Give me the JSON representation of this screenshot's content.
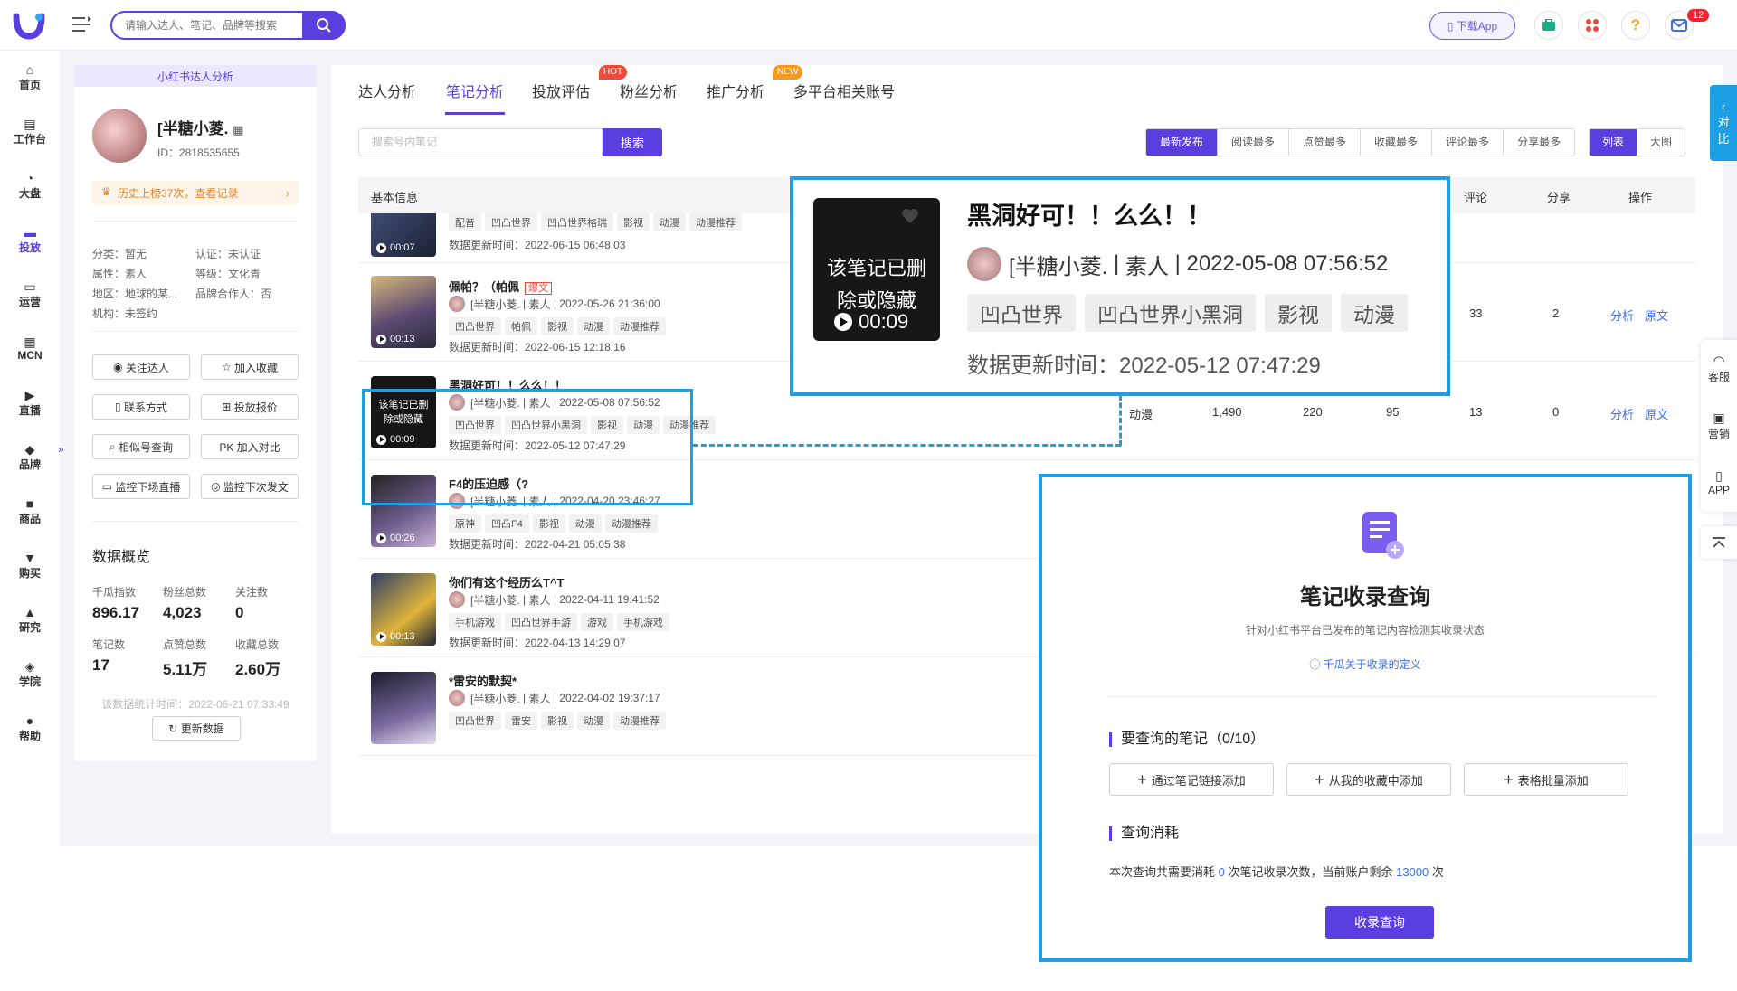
{
  "topbar": {
    "search_placeholder": "请输入达人、笔记、品牌等搜索",
    "download_app": "下载App",
    "mail_count": "12"
  },
  "nav": [
    {
      "label": "首页",
      "icon": "home-icon"
    },
    {
      "label": "工作台",
      "icon": "workbench-icon"
    },
    {
      "label": "大盘",
      "icon": "pie-chart-icon"
    },
    {
      "label": "投放",
      "icon": "folder-icon"
    },
    {
      "label": "运营",
      "icon": "chat-icon"
    },
    {
      "label": "MCN",
      "icon": "building-icon"
    },
    {
      "label": "直播",
      "icon": "camera-icon"
    },
    {
      "label": "品牌",
      "icon": "bag-icon"
    },
    {
      "label": "商品",
      "icon": "shop-icon"
    },
    {
      "label": "购买",
      "icon": "cart-icon"
    },
    {
      "label": "研究",
      "icon": "flask-icon"
    },
    {
      "label": "学院",
      "icon": "graduation-icon"
    },
    {
      "label": "帮助",
      "icon": "help-icon"
    }
  ],
  "profile": {
    "header": "小红书达人分析",
    "name": "[半糖小菱.",
    "id": "ID：2818535655",
    "history": "历史上榜37次，查看记录",
    "category": "分类：暂无",
    "cert": "认证：未认证",
    "attr": "属性：素人",
    "level": "等级：文化青",
    "region": "地区：地球的某...",
    "brand_partner": "品牌合作人：否",
    "org": "机构：未签约",
    "buttons": [
      "关注达人",
      "加入收藏",
      "联系方式",
      "投放报价",
      "相似号查询",
      "PK 加入对比",
      "监控下场直播",
      "监控下次发文"
    ],
    "overview_title": "数据概览",
    "stats": [
      {
        "label": "千瓜指数",
        "value": "896.17"
      },
      {
        "label": "粉丝总数",
        "value": "4,023"
      },
      {
        "label": "关注数",
        "value": "0"
      },
      {
        "label": "笔记数",
        "value": "17"
      },
      {
        "label": "点赞总数",
        "value": "5.11万"
      },
      {
        "label": "收藏总数",
        "value": "2.60万"
      }
    ],
    "updated": "该数据统计时间：2022-06-21 07:33:49",
    "refresh": "更新数据"
  },
  "tabs": [
    {
      "label": "达人分析"
    },
    {
      "label": "笔记分析"
    },
    {
      "label": "投放评估",
      "badge": "HOT"
    },
    {
      "label": "粉丝分析"
    },
    {
      "label": "推广分析"
    },
    {
      "label": "多平台相关账号",
      "badge": "NEW"
    }
  ],
  "note_search": {
    "placeholder": "搜索号内笔记",
    "button": "搜索"
  },
  "sort": [
    "最新发布",
    "阅读最多",
    "点赞最多",
    "收藏最多",
    "评论最多",
    "分享最多"
  ],
  "view": [
    "列表",
    "大图"
  ],
  "table": {
    "headers": {
      "basic": "基本信息",
      "comment": "评论",
      "share": "分享",
      "action": "操作"
    },
    "rows": [
      {
        "title": "",
        "duration": "00:07",
        "tags": [
          "配音",
          "凹凸世界",
          "凹凸世界格瑞",
          "影视",
          "动漫",
          "动漫推荐"
        ],
        "updated": "数据更新时间：2022-06-15 06:48:03"
      },
      {
        "title": "佩帕？（帕佩",
        "hot": "爆文",
        "duration": "00:13",
        "author": "[半糖小菱.",
        "role": "素人",
        "time": "2022-05-26 21:36:00",
        "tags": [
          "凹凸世界",
          "帕佩",
          "影视",
          "动漫",
          "动漫推荐"
        ],
        "updated": "数据更新时间：2022-06-15 12:18:16",
        "comment": "33",
        "share": "2"
      },
      {
        "title": "黑洞好可！！么么！！",
        "duration": "00:09",
        "deleted": "该笔记已删除或隐藏",
        "author": "[半糖小菱.",
        "role": "素人",
        "time": "2022-05-08 07:56:52",
        "tags": [
          "凹凸世界",
          "凹凸世界小黑洞",
          "影视",
          "动漫",
          "动漫推荐"
        ],
        "updated": "数据更新时间：2022-05-12 07:47:29",
        "category": "动漫",
        "reads": "1,490",
        "likes": "220",
        "collects": "95",
        "comment": "13",
        "share": "0"
      },
      {
        "title": "F4的压迫感（?",
        "duration": "00:26",
        "author": "[半糖小菱.",
        "role": "素人",
        "time": "2022-04-20 23:46:27",
        "tags": [
          "原神",
          "凹凸F4",
          "影视",
          "动漫",
          "动漫推荐"
        ],
        "updated": "数据更新时间：2022-04-21 05:05:38"
      },
      {
        "title": "你们有这个经历么T^T",
        "duration": "00:13",
        "author": "[半糖小菱.",
        "role": "素人",
        "time": "2022-04-11 19:41:52",
        "tags": [
          "手机游戏",
          "凹凸世界手游",
          "游戏",
          "手机游戏"
        ],
        "updated": "数据更新时间：2022-04-13 14:29:07"
      },
      {
        "title": "*雷安的默契*",
        "duration": "",
        "author": "[半糖小菱.",
        "role": "素人",
        "time": "2022-04-02 19:37:17",
        "tags": [
          "凹凸世界",
          "雷安",
          "影视",
          "动漫",
          "动漫推荐"
        ]
      }
    ],
    "actions": {
      "analyze": "分析",
      "source": "原文"
    }
  },
  "zoom": {
    "deleted": "该笔记已删除或隐藏",
    "duration": "00:09",
    "title": "黑洞好可！！么么！！",
    "author": "[半糖小菱.",
    "role": "素人",
    "time": "2022-05-08 07:56:52",
    "tags": [
      "凹凸世界",
      "凹凸世界小黑洞",
      "影视",
      "动漫"
    ],
    "updated": "数据更新时间：2022-05-12 07:47:29"
  },
  "query": {
    "title": "笔记收录查询",
    "subtitle": "针对小红书平台已发布的笔记内容检测其收录状态",
    "link": "千瓜关于收录的定义",
    "section1": "要查询的笔记（0/10）",
    "buttons": [
      "通过笔记链接添加",
      "从我的收藏中添加",
      "表格批量添加"
    ],
    "section2": "查询消耗",
    "cost_pre": "本次查询共需要消耗",
    "cost_num": "0",
    "cost_mid": "次笔记收录次数，当前账户剩余",
    "cost_left": "13000",
    "cost_post": "次",
    "submit": "收录查询"
  },
  "right": {
    "compare": [
      "对",
      "比"
    ],
    "service": "客服",
    "marketing": "营销",
    "app": "APP"
  }
}
